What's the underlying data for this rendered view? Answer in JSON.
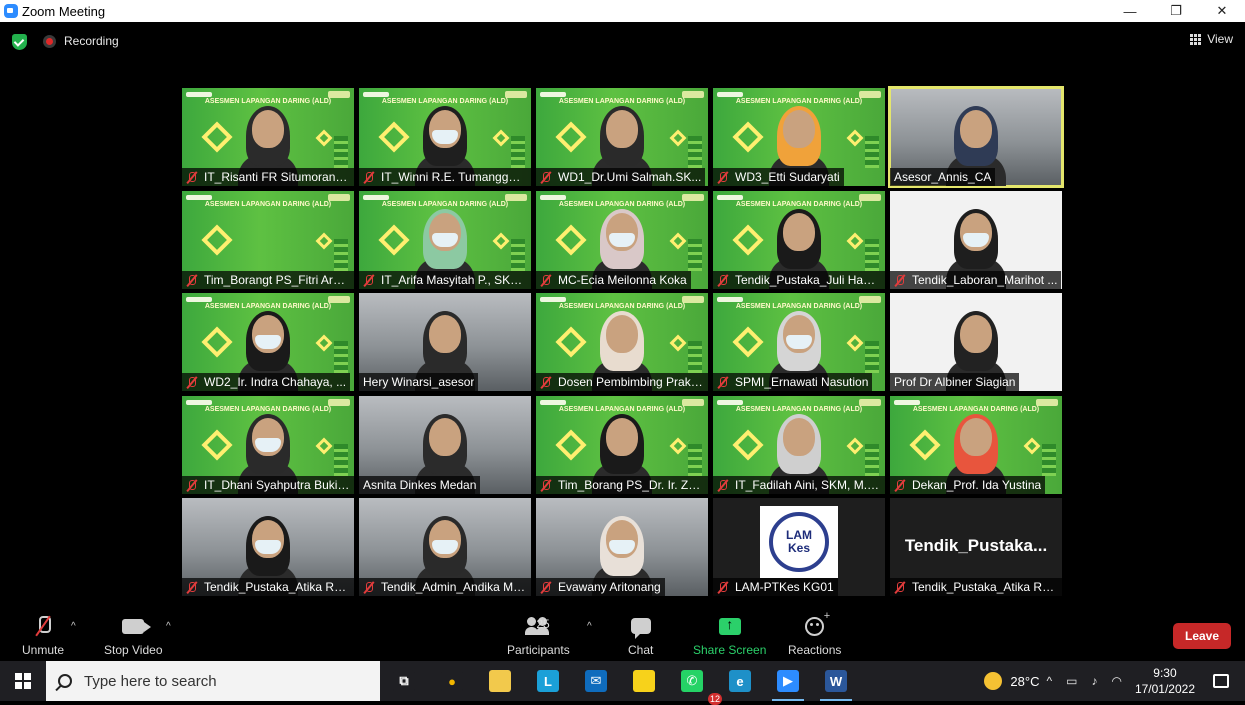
{
  "window": {
    "title": "Zoom Meeting",
    "minimize": "—",
    "maximize": "❐",
    "close": "✕"
  },
  "status": {
    "recording": "Recording",
    "view": "View"
  },
  "slide": {
    "banner": "ASESMEN LAPANGAN DARING (ALD)"
  },
  "tiles": [
    {
      "name": "IT_Risanti FR Situmorang ...",
      "style": "green",
      "person": "#2b2b2b",
      "mask": false,
      "muted": true
    },
    {
      "name": "IT_Winni R.E. Tumanggor ...",
      "style": "green",
      "person": "#1f1f1f",
      "mask": true,
      "muted": true
    },
    {
      "name": "WD1_Dr.Umi Salmah.SK...",
      "style": "green",
      "person": "#2a2a2a",
      "mask": false,
      "muted": true
    },
    {
      "name": "WD3_Etti Sudaryati",
      "style": "green",
      "person": "#f0a23a",
      "mask": false,
      "muted": true
    },
    {
      "name": "Asesor_Annis_CA",
      "style": "photo",
      "person": "#2f3b55",
      "mask": false,
      "muted": false,
      "active": true
    },
    {
      "name": "Tim_Borangt PS_Fitri Ardi...",
      "style": "green",
      "person": "",
      "mask": false,
      "muted": true
    },
    {
      "name": "IT_Arifa Masyitah P., SKM...",
      "style": "green",
      "person": "#8cc9a2",
      "mask": true,
      "muted": true
    },
    {
      "name": "MC-Ecia Meilonna Koka",
      "style": "green",
      "person": "#d9c8c8",
      "mask": true,
      "muted": true
    },
    {
      "name": "Tendik_Pustaka_Juli Hand...",
      "style": "green",
      "person": "#1a1a1a",
      "mask": false,
      "muted": true
    },
    {
      "name": "Tendik_Laboran_Marihot ...",
      "style": "white",
      "person": "#1e1e1e",
      "mask": true,
      "muted": true
    },
    {
      "name": "WD2_Ir. Indra Chahaya, ...",
      "style": "green",
      "person": "#1a1a1a",
      "mask": true,
      "muted": true
    },
    {
      "name": "Hery Winarsi_asesor",
      "style": "photo",
      "person": "#2a2a2a",
      "mask": false,
      "muted": false
    },
    {
      "name": "Dosen Pembimbing Prakt...",
      "style": "green",
      "person": "#e8dccf",
      "mask": false,
      "muted": true
    },
    {
      "name": "SPMI_Ernawati Nasution",
      "style": "green",
      "person": "#d5d5d5",
      "mask": true,
      "muted": true
    },
    {
      "name": "Prof Dr Albiner Siagian",
      "style": "white",
      "person": "#222",
      "mask": false,
      "muted": false
    },
    {
      "name": "IT_Dhani Syahputra Bukit,...",
      "style": "green",
      "person": "#2a2a2a",
      "mask": true,
      "muted": true
    },
    {
      "name": "Asnita Dinkes Medan",
      "style": "photo",
      "person": "#2b2b2b",
      "mask": false,
      "muted": false
    },
    {
      "name": "Tim_Borang PS_Dr. Ir. Zul...",
      "style": "green",
      "person": "#1a1a1a",
      "mask": false,
      "muted": true
    },
    {
      "name": "IT_Fadilah Aini, SKM, M.Kes",
      "style": "green",
      "person": "#cfcfcf",
      "mask": false,
      "muted": true
    },
    {
      "name": "Dekan_Prof. Ida Yustina",
      "style": "green",
      "person": "#e8553d",
      "mask": false,
      "muted": true
    },
    {
      "name": "Tendik_Pustaka_Atika Ra...",
      "style": "photo",
      "person": "#1a1a1a",
      "mask": true,
      "muted": true
    },
    {
      "name": "Tendik_Admin_Andika Ma...",
      "style": "photo",
      "person": "#2a2a2a",
      "mask": true,
      "muted": true
    },
    {
      "name": "Evawany Aritonang",
      "style": "photo",
      "person": "#e8e0d8",
      "mask": true,
      "muted": true
    },
    {
      "name": "LAM-PTKes KG01",
      "style": "lamkes",
      "muted": true,
      "logo_line1": "LAM",
      "logo_line2": "Kes"
    },
    {
      "name": "Tendik_Pustaka_Atika Ra...",
      "style": "dark",
      "big_name": "Tendik_Pustaka...",
      "muted": true
    }
  ],
  "toolbar": {
    "unmute": "Unmute",
    "stop_video": "Stop Video",
    "participants": "Participants",
    "participants_count": "25",
    "chat": "Chat",
    "share_screen": "Share Screen",
    "reactions": "Reactions",
    "leave": "Leave",
    "caret": "^"
  },
  "taskbar": {
    "search_placeholder": "Type here to search",
    "apps": [
      {
        "name": "task-view",
        "label": "⧉",
        "color": "#1f1f23",
        "fg": "#ffffff"
      },
      {
        "name": "chrome",
        "label": "●",
        "color": "#1f1f23",
        "fg": "#f2b600"
      },
      {
        "name": "file-explorer",
        "label": "",
        "color": "#f2c94c",
        "fg": "#ffffff"
      },
      {
        "name": "app-l",
        "label": "L",
        "color": "#1ba0d8",
        "fg": "#ffffff"
      },
      {
        "name": "mail",
        "label": "✉",
        "color": "#0f6cbd",
        "fg": "#ffffff"
      },
      {
        "name": "sticky-notes",
        "label": "",
        "color": "#f7d21b",
        "fg": "#000000"
      },
      {
        "name": "whatsapp",
        "label": "✆",
        "color": "#25d366",
        "fg": "#ffffff",
        "badge": "12"
      },
      {
        "name": "edge",
        "label": "e",
        "color": "#1e90c8",
        "fg": "#ffffff"
      },
      {
        "name": "zoom",
        "label": "▶",
        "color": "#2d8cff",
        "fg": "#ffffff",
        "active": true
      },
      {
        "name": "word",
        "label": "W",
        "color": "#2b579a",
        "fg": "#ffffff",
        "active": true
      }
    ],
    "temperature": "28°C",
    "time": "9:30",
    "date": "17/01/2022",
    "tray_up": "^"
  }
}
